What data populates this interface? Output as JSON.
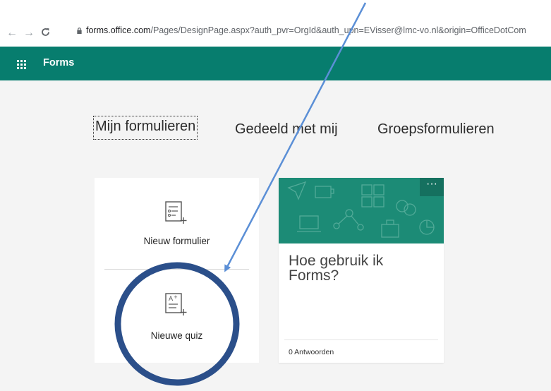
{
  "browser": {
    "url_host": "forms.office.com",
    "url_path": "/Pages/DesignPage.aspx?auth_pvr=OrgId&auth_upn=EVisser@lmc-vo.nl&origin=OfficeDotCom"
  },
  "app": {
    "title": "Forms"
  },
  "tabs": [
    {
      "label": "Mijn formulieren"
    },
    {
      "label": "Gedeeld met mij"
    },
    {
      "label": "Groepsformulieren"
    }
  ],
  "new_items": {
    "form_label": "Nieuw formulier",
    "quiz_label": "Nieuwe quiz"
  },
  "demo_form": {
    "title": "Hoe gebruik ik Forms?",
    "responses": "0 Antwoorden",
    "more": "···"
  },
  "colors": {
    "appbar": "#077d6e",
    "banner": "#1c8b76",
    "annotation": "#2b4f8a",
    "arrow": "#5b8fd6"
  }
}
